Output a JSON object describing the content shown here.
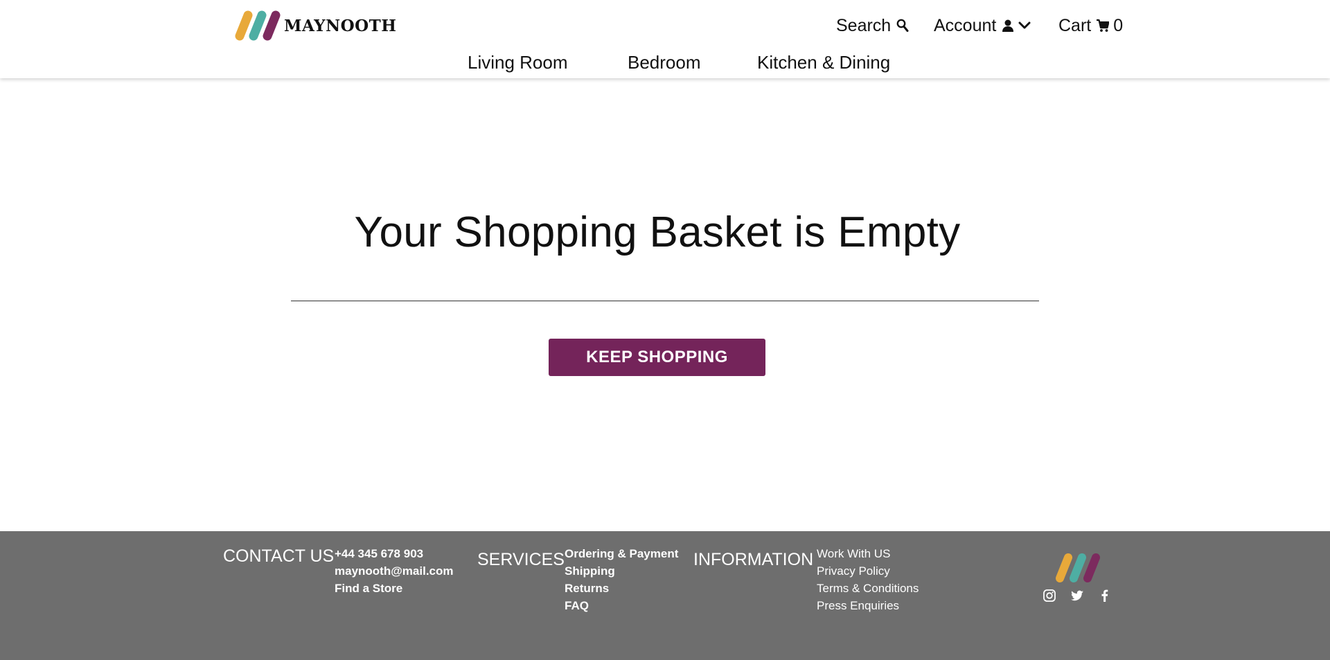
{
  "brand": {
    "name": "MAYNOOTH",
    "colors": {
      "yellow": "#e8a93a",
      "teal": "#4eaea3",
      "plum": "#7c2a5e",
      "button": "#74245a",
      "footer": "#6e6e6e"
    }
  },
  "header": {
    "search_label": "Search",
    "account_label": "Account",
    "cart_label": "Cart",
    "cart_count": "0",
    "icons": [
      "search-icon",
      "user-icon",
      "chevron-down-icon",
      "cart-icon"
    ]
  },
  "nav": {
    "items": [
      {
        "label": "Living Room"
      },
      {
        "label": "Bedroom"
      },
      {
        "label": "Kitchen & Dining"
      }
    ]
  },
  "main": {
    "title": "Your Shopping Basket is Empty",
    "cta_label": "KEEP SHOPPING"
  },
  "footer": {
    "contact": {
      "heading": "CONTACT US",
      "items": [
        "+44 345 678 903",
        "maynooth@mail.com",
        "Find a Store"
      ]
    },
    "services": {
      "heading": "SERVICES",
      "items": [
        "Ordering & Payment",
        "Shipping",
        "Returns",
        "FAQ"
      ]
    },
    "information": {
      "heading": "INFORMATION",
      "items": [
        "Work With US",
        "Privacy Policy",
        "Terms & Conditions",
        "Press Enquiries"
      ]
    },
    "social_icons": [
      "instagram-icon",
      "twitter-icon",
      "facebook-icon"
    ]
  }
}
